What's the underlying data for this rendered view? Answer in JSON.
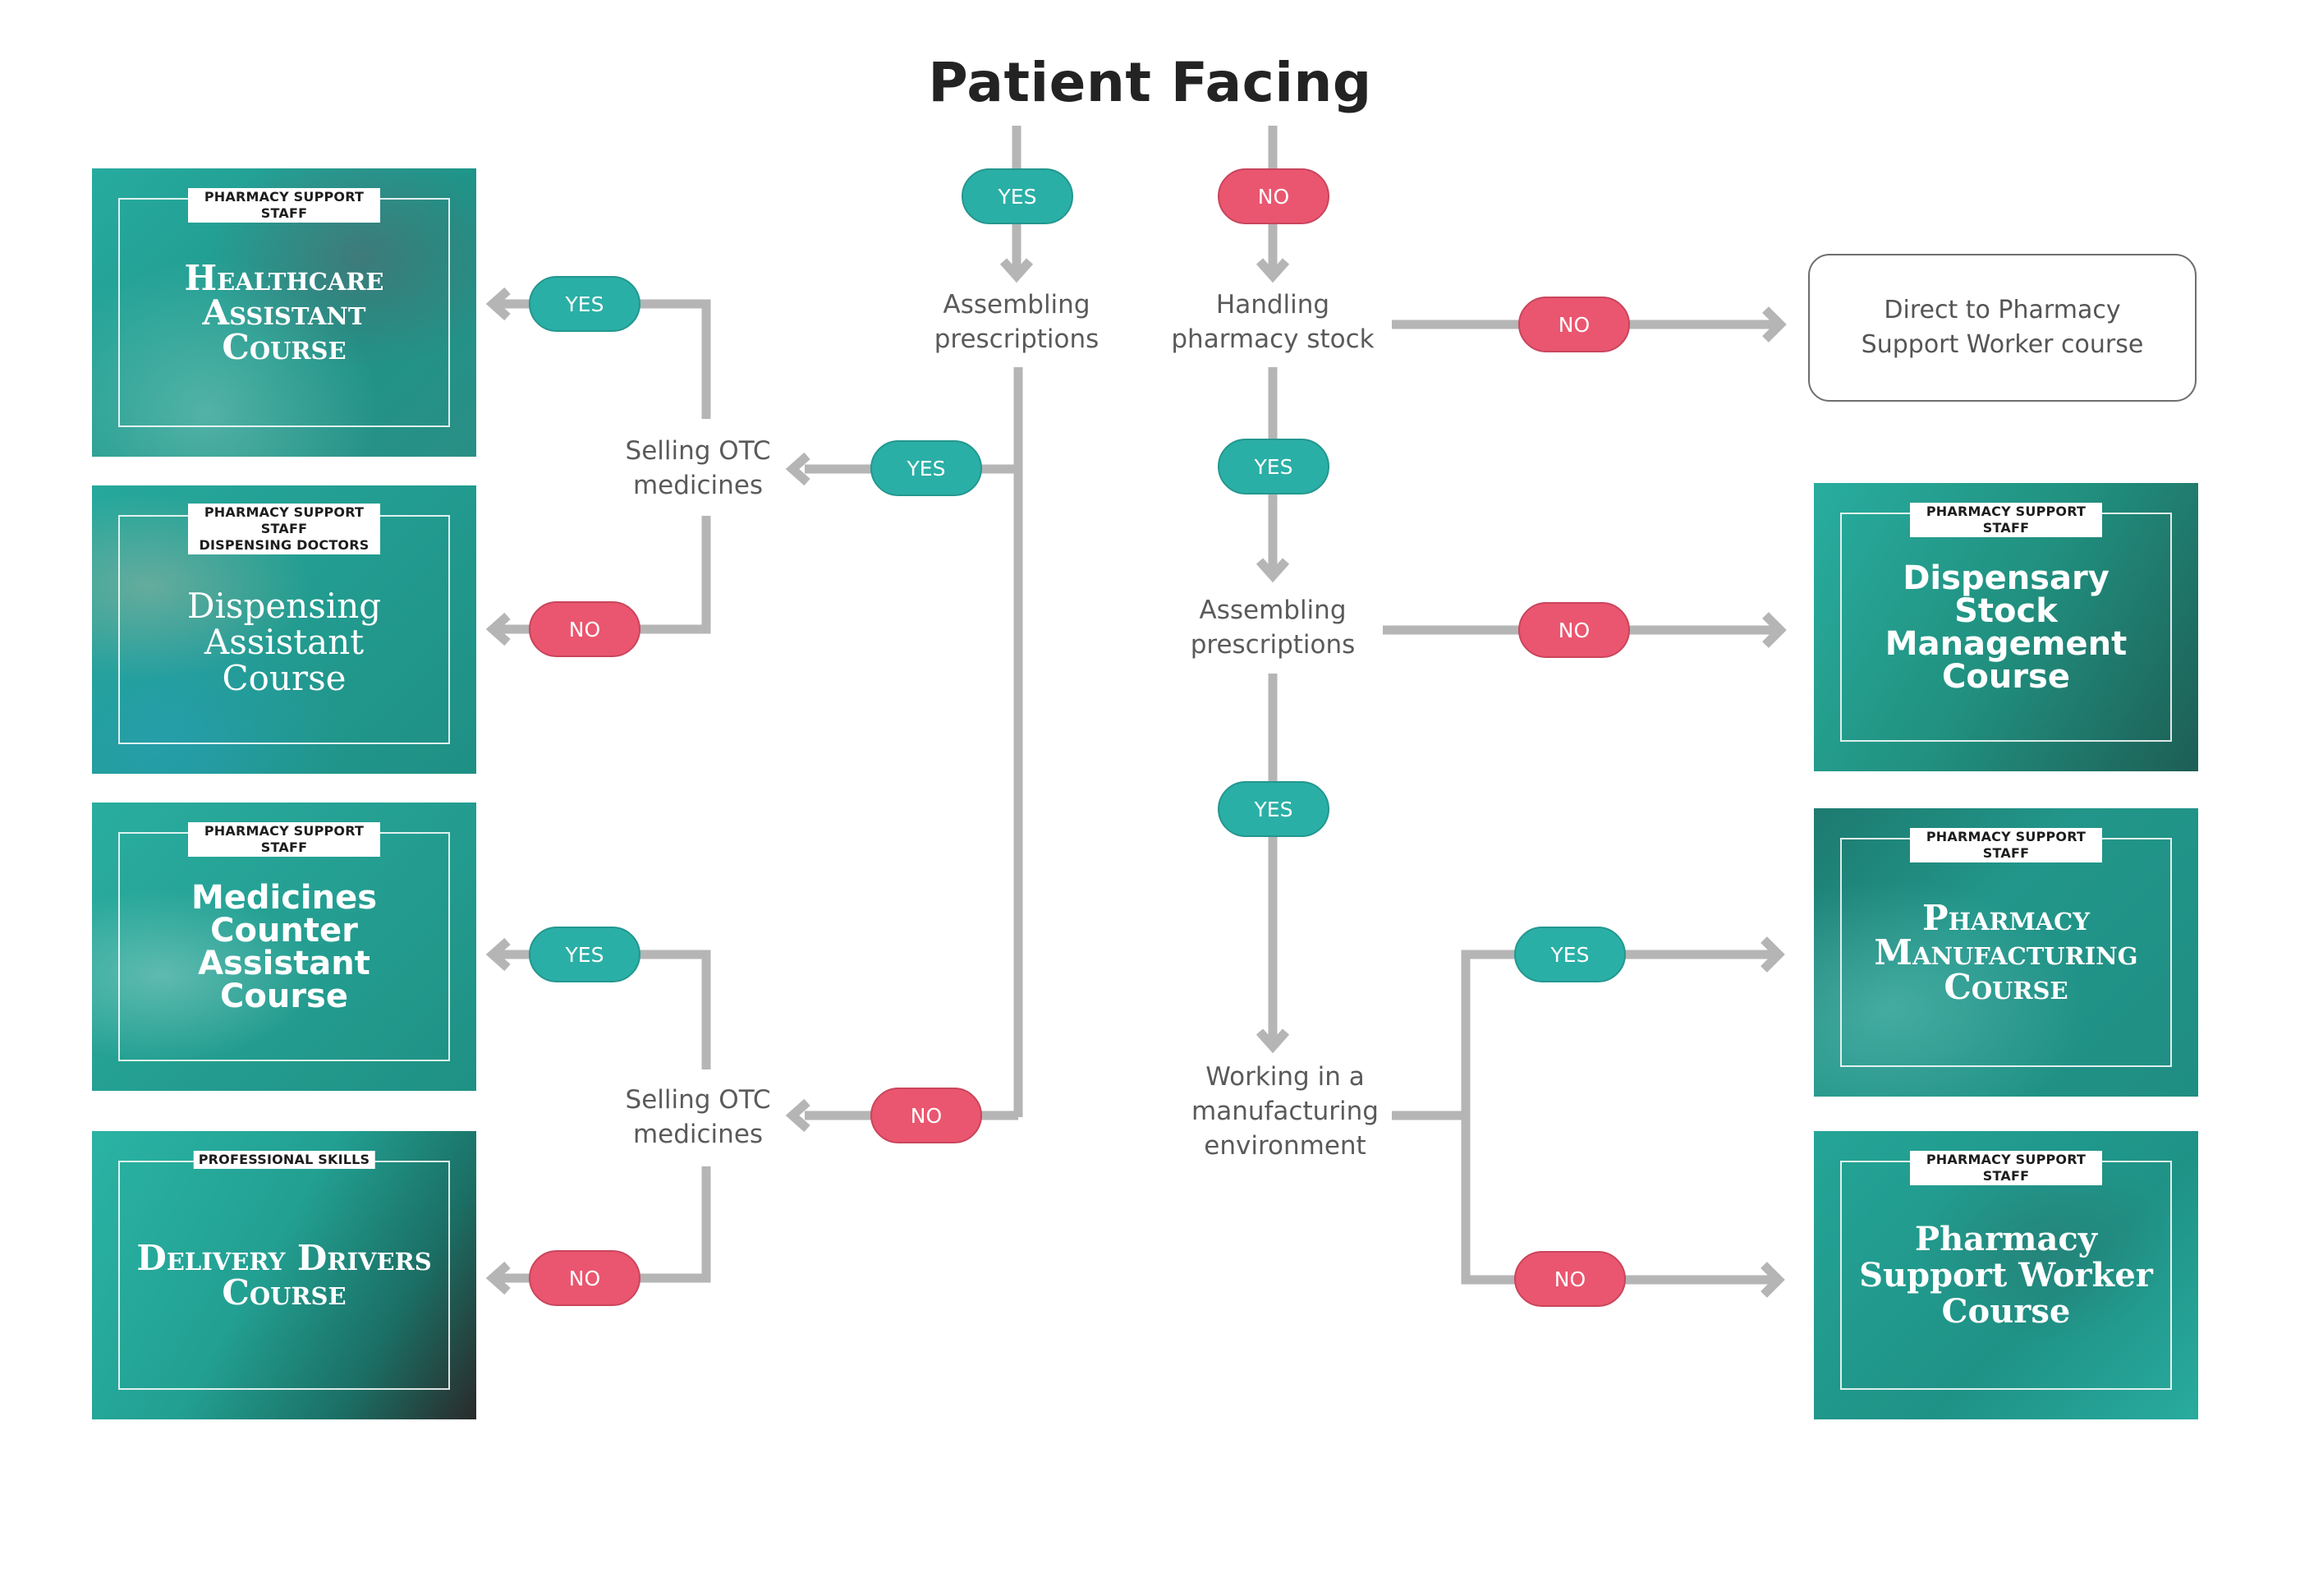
{
  "title": "Patient Facing",
  "colors": {
    "yes": "#2aafa6",
    "no": "#ea566f",
    "connector": "#b5b5b5",
    "card_teal": "#1fa89b",
    "card_dark": "#1d5e55"
  },
  "pills": {
    "top_yes": "YES",
    "top_no": "NO",
    "assembling_yes": "YES",
    "assembling_no": "NO",
    "selling1_yes": "YES",
    "selling1_no": "NO",
    "selling2_yes": "YES",
    "selling2_no": "NO",
    "handling_no": "NO",
    "handling_yes": "YES",
    "assembling2_no": "NO",
    "assembling2_yes": "YES",
    "manufacturing_yes": "YES",
    "manufacturing_no": "NO"
  },
  "nodes": {
    "assembling_prescriptions": "Assembling\nprescriptions",
    "handling_pharmacy_stock": "Handling\npharmacy stock",
    "selling_otc_1": "Selling OTC\nmedicines",
    "selling_otc_2": "Selling OTC\nmedicines",
    "assembling_prescriptions_2": "Assembling\nprescriptions",
    "working_manufacturing": "Working in a\nmanufacturing\nenvironment"
  },
  "direct_box": "Direct to Pharmacy\nSupport Worker course",
  "cards": [
    {
      "tag": "PHARMACY SUPPORT STAFF",
      "title": "Healthcare\nAssistant\nCourse"
    },
    {
      "tag": "PHARMACY SUPPORT STAFF\nDISPENSING DOCTORS",
      "title": "Dispensing\nAssistant\nCourse"
    },
    {
      "tag": "PHARMACY SUPPORT STAFF",
      "title": "Medicines\nCounter\nAssistant\nCourse"
    },
    {
      "tag": "PROFESSIONAL SKILLS",
      "title": "Delivery Drivers\nCourse"
    },
    {
      "tag": "PHARMACY SUPPORT STAFF",
      "title": "Dispensary\nStock\nManagement\nCourse"
    },
    {
      "tag": "PHARMACY SUPPORT STAFF",
      "title": "Pharmacy\nManufacturing\nCourse"
    },
    {
      "tag": "PHARMACY SUPPORT STAFF",
      "title": "Pharmacy\nSupport Worker\nCourse"
    }
  ]
}
